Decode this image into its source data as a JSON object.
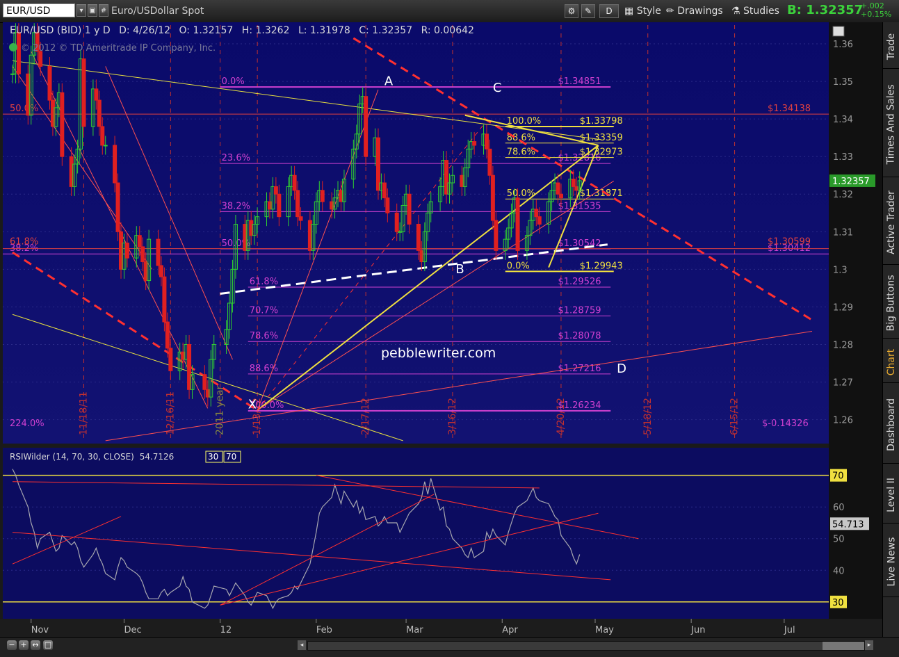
{
  "toolbar": {
    "symbol": "EUR/USD",
    "description": "Euro/USDollar Spot",
    "mode_badge": "D",
    "style_label": "Style",
    "drawings_label": "Drawings",
    "studies_label": "Studies",
    "bid_label": "B:",
    "bid_value": "1.32357",
    "change_abs": "+.002",
    "change_pct": "+0.15%"
  },
  "rail_tabs": [
    "Trade",
    "Times And Sales",
    "Active Trader",
    "Big Buttons",
    "Chart",
    "Dashboard",
    "Level II",
    "Live News"
  ],
  "rail_active": "Chart",
  "chart_data": {
    "type": "candlestick",
    "price_panel": {
      "header": {
        "instrument": "EUR/USD (BID) 1 y D",
        "date": "D: 4/26/12",
        "open": "O: 1.32157",
        "high": "H: 1.3262",
        "low": "L: 1.31978",
        "close": "C: 1.32357",
        "range": "R: 0.00642"
      },
      "copyright": "© 2012 © TD Ameritrade IP Company, Inc.",
      "watermark": "pebblewriter.com",
      "ylim": [
        1.254,
        1.365
      ],
      "y_ticks": [
        1.36,
        1.35,
        1.34,
        1.33,
        1.32,
        1.31,
        1.3,
        1.29,
        1.28,
        1.27,
        1.26
      ],
      "last_price": "1.32357",
      "date_lines": [
        {
          "x": "2011-11-18",
          "label": "11/18/11"
        },
        {
          "x": "2011-12-16",
          "label": "12/16/11"
        },
        {
          "x": "2012-01-01",
          "label": "2011 year"
        },
        {
          "x": "2012-01-13",
          "label": "1/13/12"
        },
        {
          "x": "2012-02-17",
          "label": "2/17/12"
        },
        {
          "x": "2012-03-16",
          "label": "3/16/12"
        },
        {
          "x": "2012-04-20",
          "label": "4/20/12"
        },
        {
          "x": "2012-05-18",
          "label": "5/18/12"
        },
        {
          "x": "2012-06-15",
          "label": "6/15/12"
        }
      ],
      "closes": [
        [
          "2011-10-26",
          1.352
        ],
        [
          "2011-10-27",
          1.363
        ],
        [
          "2011-10-28",
          1.352
        ],
        [
          "2011-10-31",
          1.341
        ],
        [
          "2011-11-01",
          1.357
        ],
        [
          "2011-11-02",
          1.363
        ],
        [
          "2011-11-03",
          1.358
        ],
        [
          "2011-11-04",
          1.354
        ],
        [
          "2011-11-07",
          1.345
        ],
        [
          "2011-11-08",
          1.338
        ],
        [
          "2011-11-09",
          1.343
        ],
        [
          "2011-11-10",
          1.347
        ],
        [
          "2011-11-11",
          1.33
        ],
        [
          "2011-11-14",
          1.322
        ],
        [
          "2011-11-15",
          1.328
        ],
        [
          "2011-11-16",
          1.332
        ],
        [
          "2011-11-17",
          1.356
        ],
        [
          "2011-11-18",
          1.338
        ],
        [
          "2011-11-21",
          1.348
        ],
        [
          "2011-11-22",
          1.345
        ],
        [
          "2011-11-23",
          1.338
        ],
        [
          "2011-11-24",
          1.333
        ],
        [
          "2011-11-25",
          1.333
        ],
        [
          "2011-11-28",
          1.323
        ],
        [
          "2011-11-29",
          1.31
        ],
        [
          "2011-11-30",
          1.3
        ],
        [
          "2011-12-01",
          1.307
        ],
        [
          "2011-12-02",
          1.303
        ],
        [
          "2011-12-05",
          1.309
        ],
        [
          "2011-12-06",
          1.306
        ],
        [
          "2011-12-07",
          1.302
        ],
        [
          "2011-12-08",
          1.297
        ],
        [
          "2011-12-09",
          1.308
        ],
        [
          "2011-12-12",
          1.301
        ],
        [
          "2011-12-13",
          1.298
        ],
        [
          "2011-12-14",
          1.286
        ],
        [
          "2011-12-15",
          1.279
        ],
        [
          "2011-12-16",
          1.273
        ],
        [
          "2011-12-19",
          1.278
        ],
        [
          "2011-12-20",
          1.276
        ],
        [
          "2011-12-21",
          1.28
        ],
        [
          "2011-12-22",
          1.268
        ],
        [
          "2011-12-23",
          1.272
        ],
        [
          "2011-12-27",
          1.268
        ],
        [
          "2011-12-28",
          1.266
        ],
        [
          "2011-12-29",
          1.276
        ],
        [
          "2011-12-30",
          1.28
        ],
        [
          "2012-01-03",
          1.284
        ],
        [
          "2012-01-04",
          1.291
        ],
        [
          "2012-01-05",
          1.3
        ],
        [
          "2012-01-06",
          1.312
        ],
        [
          "2012-01-09",
          1.305
        ],
        [
          "2012-01-10",
          1.313
        ],
        [
          "2012-01-11",
          1.309
        ],
        [
          "2012-01-12",
          1.312
        ],
        [
          "2012-01-13",
          1.314
        ],
        [
          "2012-01-16",
          1.318
        ],
        [
          "2012-01-17",
          1.316
        ],
        [
          "2012-01-18",
          1.322
        ],
        [
          "2012-01-19",
          1.32
        ],
        [
          "2012-01-20",
          1.314
        ],
        [
          "2012-01-23",
          1.322
        ],
        [
          "2012-01-24",
          1.325
        ],
        [
          "2012-01-25",
          1.321
        ],
        [
          "2012-01-26",
          1.314
        ],
        [
          "2012-01-27",
          1.313
        ],
        [
          "2012-01-30",
          1.305
        ],
        [
          "2012-01-31",
          1.312
        ],
        [
          "2012-02-01",
          1.318
        ],
        [
          "2012-02-02",
          1.321
        ],
        [
          "2012-02-03",
          1.318
        ],
        [
          "2012-02-06",
          1.316
        ],
        [
          "2012-02-07",
          1.319
        ],
        [
          "2012-02-08",
          1.321
        ],
        [
          "2012-02-09",
          1.318
        ],
        [
          "2012-02-10",
          1.324
        ],
        [
          "2012-02-13",
          1.332
        ],
        [
          "2012-02-14",
          1.336
        ],
        [
          "2012-02-15",
          1.344
        ],
        [
          "2012-02-16",
          1.346
        ],
        [
          "2012-02-17",
          1.33
        ],
        [
          "2012-02-20",
          1.335
        ],
        [
          "2012-02-21",
          1.321
        ],
        [
          "2012-02-22",
          1.323
        ],
        [
          "2012-02-23",
          1.319
        ],
        [
          "2012-02-24",
          1.315
        ],
        [
          "2012-02-27",
          1.31
        ],
        [
          "2012-02-28",
          1.31
        ],
        [
          "2012-02-29",
          1.317
        ],
        [
          "2012-03-01",
          1.32
        ],
        [
          "2012-03-02",
          1.312
        ],
        [
          "2012-03-05",
          1.305
        ],
        [
          "2012-03-06",
          1.302
        ],
        [
          "2012-03-07",
          1.31
        ],
        [
          "2012-03-08",
          1.315
        ],
        [
          "2012-03-09",
          1.318
        ],
        [
          "2012-03-12",
          1.322
        ],
        [
          "2012-03-13",
          1.329
        ],
        [
          "2012-03-14",
          1.32
        ],
        [
          "2012-03-15",
          1.323
        ],
        [
          "2012-03-16",
          1.325
        ],
        [
          "2012-03-19",
          1.322
        ],
        [
          "2012-03-20",
          1.327
        ],
        [
          "2012-03-21",
          1.332
        ],
        [
          "2012-03-22",
          1.334
        ],
        [
          "2012-03-23",
          1.333
        ],
        [
          "2012-03-26",
          1.336
        ],
        [
          "2012-03-27",
          1.332
        ],
        [
          "2012-03-28",
          1.325
        ],
        [
          "2012-03-29",
          1.313
        ],
        [
          "2012-03-30",
          1.305
        ],
        [
          "2012-04-02",
          1.308
        ],
        [
          "2012-04-03",
          1.311
        ],
        [
          "2012-04-04",
          1.315
        ],
        [
          "2012-04-05",
          1.319
        ],
        [
          "2012-04-06",
          1.305
        ],
        [
          "2012-04-09",
          1.309
        ],
        [
          "2012-04-10",
          1.313
        ],
        [
          "2012-04-11",
          1.316
        ],
        [
          "2012-04-12",
          1.314
        ],
        [
          "2012-04-13",
          1.312
        ],
        [
          "2012-04-16",
          1.318
        ],
        [
          "2012-04-17",
          1.321
        ],
        [
          "2012-04-18",
          1.323
        ],
        [
          "2012-04-19",
          1.32
        ],
        [
          "2012-04-20",
          1.319
        ],
        [
          "2012-04-23",
          1.324
        ],
        [
          "2012-04-24",
          1.322
        ],
        [
          "2012-04-25",
          1.321
        ],
        [
          "2012-04-26",
          1.32357
        ]
      ],
      "fib_left": {
        "levels": [
          "0.0%",
          "23.6%",
          "38.2%",
          "50.0%",
          "61.8%",
          "70.7%",
          "78.6%",
          "88.6%",
          "100.0%"
        ],
        "prices": [
          "$1.34851",
          "$1.32816",
          "$1.31535",
          "$1.30542",
          "$1.29526",
          "$1.28759",
          "$1.28078",
          "$1.27216",
          "$1.26234"
        ]
      },
      "fib_right": {
        "levels": [
          "100.0%",
          "88.6%",
          "78.6%",
          "50.0%",
          "0.0%"
        ],
        "prices": [
          "$1.33798",
          "$1.33359",
          "$1.32973",
          "$1.31871",
          "$1.29943"
        ]
      },
      "side_labels": {
        "fifty": "50.0%",
        "thirty_eight": "38.2%",
        "sixty_one": "61.8%",
        "two_twenty_four": "224.0%",
        "price_1_3413": "$1.34138",
        "price_1_3041": "$1.30412",
        "price_1_3059": "$1.30599",
        "price_neg": "$-0.14326"
      },
      "pattern_points": [
        "X",
        "A",
        "B",
        "C",
        "D"
      ]
    },
    "rsi_panel": {
      "label": "RSIWilder (14, 70, 30, CLOSE)",
      "value": "54.7126",
      "over_bought": "30",
      "over_sold": "70",
      "last_value": "54.713",
      "ylim": [
        26,
        73
      ],
      "y_ticks": [
        70,
        60,
        50,
        40,
        30
      ],
      "values": [
        72,
        70,
        67,
        60,
        55,
        52,
        47,
        50,
        52,
        49,
        46,
        47,
        51,
        48,
        49,
        47,
        43,
        41,
        45,
        47,
        44,
        42,
        39,
        37,
        41,
        44,
        43,
        41,
        39,
        38,
        36,
        33,
        31,
        31,
        33,
        34,
        32,
        33,
        35,
        38,
        35,
        34,
        30,
        28,
        29,
        32,
        35,
        34,
        32,
        34,
        36,
        32,
        30,
        29,
        31,
        33,
        32,
        30,
        28,
        30,
        31,
        32,
        33,
        35,
        34,
        36,
        42,
        47,
        52,
        58,
        60,
        63,
        67,
        64,
        61,
        65,
        60,
        62,
        58,
        60,
        56,
        57,
        54,
        55,
        57,
        55,
        55,
        52,
        54,
        56,
        58,
        61,
        63,
        68,
        64,
        69,
        59,
        60,
        54,
        53,
        50,
        47,
        45,
        44,
        47,
        44,
        46,
        52,
        50,
        53,
        51,
        48,
        52,
        55,
        58,
        60,
        62,
        64,
        66,
        63,
        62,
        61,
        59,
        57,
        56,
        51,
        47,
        44,
        42,
        45,
        46,
        44,
        47,
        50,
        51,
        48,
        52,
        51,
        53,
        56,
        52,
        50,
        51,
        54,
        54.7
      ]
    },
    "x_axis": [
      "Nov",
      "Dec",
      "12",
      "Feb",
      "Mar",
      "Apr",
      "May",
      "Jun",
      "Jul"
    ]
  }
}
